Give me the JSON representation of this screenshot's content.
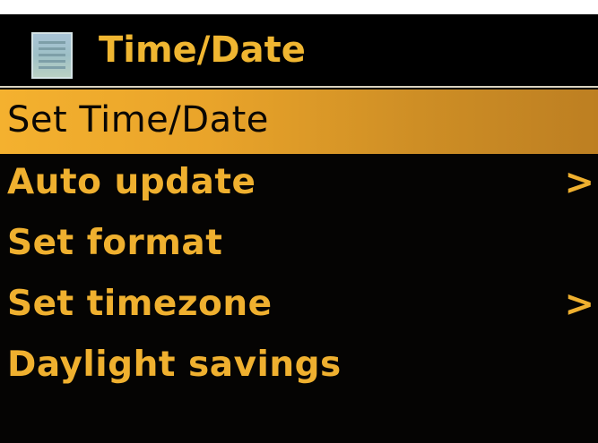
{
  "header": {
    "title": "Time/Date",
    "icon": "menu-list-icon"
  },
  "menu": {
    "items": [
      {
        "label": "Set Time/Date",
        "selected": true,
        "arrow": ""
      },
      {
        "label": "Auto update",
        "selected": false,
        "arrow": ">"
      },
      {
        "label": "Set format",
        "selected": false,
        "arrow": ""
      },
      {
        "label": "Set timezone",
        "selected": false,
        "arrow": ">"
      },
      {
        "label": "Daylight savings",
        "selected": false,
        "arrow": ""
      }
    ]
  },
  "colors": {
    "accent": "#f0b631",
    "background": "#000000",
    "highlight": "#e9a42a"
  }
}
